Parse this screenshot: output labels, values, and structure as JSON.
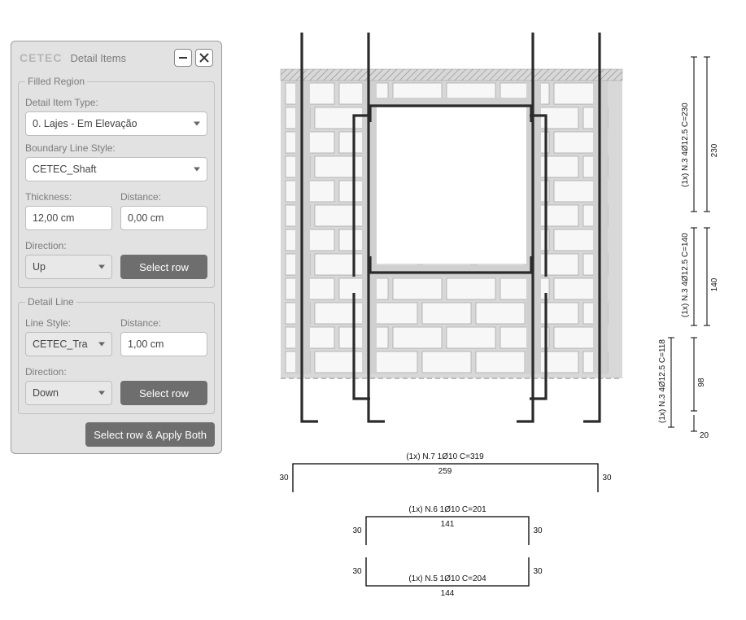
{
  "window": {
    "logo_text": "CETEC",
    "title": "Detail Items"
  },
  "filled_region": {
    "legend": "Filled Region",
    "detail_item_type_label": "Detail Item Type:",
    "detail_item_type_value": "0. Lajes - Em Elevação",
    "boundary_label": "Boundary Line Style:",
    "boundary_value": "CETEC_Shaft",
    "thickness_label": "Thickness:",
    "thickness_value": "12,00 cm",
    "distance_label": "Distance:",
    "distance_value": "0,00 cm",
    "direction_label": "Direction:",
    "direction_value": "Up",
    "select_row_label": "Select row"
  },
  "detail_line": {
    "legend": "Detail Line",
    "line_style_label": "Line Style:",
    "line_style_value": "CETEC_Tra",
    "distance_label": "Distance:",
    "distance_value": "1,00 cm",
    "direction_label": "Direction:",
    "direction_value": "Down",
    "select_row_label": "Select row"
  },
  "footer": {
    "apply_both_label": "Select row & Apply Both"
  },
  "annotations": {
    "right1_spec": "(1x)  N.3  4Ø12.5  C=230",
    "right1_dim": "230",
    "right2_spec": "(1x)  N.3  4Ø12.5  C=140",
    "right2_dim": "140",
    "right3_spec": "(1x)  N.3  4Ø12.5  C=118",
    "right3_dim1": "98",
    "right3_dim2": "20",
    "bottom1_spec": "(1x)  N.7  1Ø10  C=319",
    "bottom1_dim": "259",
    "bottom1_hook_l": "30",
    "bottom1_hook_r": "30",
    "bottom2_spec": "(1x)  N.6  1Ø10  C=201",
    "bottom2_dim": "141",
    "bottom2_hook_l": "30",
    "bottom2_hook_r": "30",
    "bottom3_spec": "(1x)  N.5  1Ø10  C=204",
    "bottom3_dim": "144",
    "bottom3_hook_l": "30",
    "bottom3_hook_r": "30"
  },
  "colors": {
    "rebar": "#333333",
    "brick": "#f1f1f1",
    "mortar": "#d1d1d1",
    "bg": "#ffffff"
  }
}
